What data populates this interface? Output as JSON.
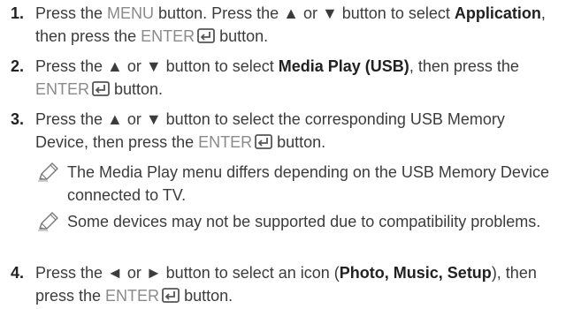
{
  "steps": [
    {
      "number": "1.",
      "segments": [
        {
          "text": "Press the ",
          "style": "plain"
        },
        {
          "text": "MENU",
          "style": "gray"
        },
        {
          "text": " button. Press the ▲  or ▼  button to select ",
          "style": "plain"
        },
        {
          "text": "Application",
          "style": "bold"
        },
        {
          "text": ", then press the ",
          "style": "plain"
        },
        {
          "text": "ENTER",
          "style": "gray"
        },
        {
          "text": " button.",
          "style": "plain"
        }
      ]
    },
    {
      "number": "2.",
      "segments": [
        {
          "text": "Press the ▲ or ▼ button to select ",
          "style": "plain"
        },
        {
          "text": "Media Play (USB)",
          "style": "bold"
        },
        {
          "text": ", then press the ",
          "style": "plain"
        },
        {
          "text": "ENTER",
          "style": "gray"
        },
        {
          "text": " button.",
          "style": "plain"
        }
      ]
    },
    {
      "number": "3.",
      "segments": [
        {
          "text": "Press the ▲ or ▼  button to select the corresponding USB Memory Device, then press the ",
          "style": "plain"
        },
        {
          "text": "ENTER",
          "style": "gray"
        },
        {
          "text": " button.",
          "style": "plain"
        }
      ]
    },
    {
      "number": "4.",
      "segments": [
        {
          "text": "Press the ◄ or ► button to select an icon (",
          "style": "plain"
        },
        {
          "text": "Photo, Music, Setup",
          "style": "bold"
        },
        {
          "text": "), then press the ",
          "style": "plain"
        },
        {
          "text": "ENTER",
          "style": "gray"
        },
        {
          "text": " button.",
          "style": "plain"
        }
      ]
    }
  ],
  "notes": [
    {
      "icon": "pencil-note-icon",
      "text": "The Media Play menu differs depending on the USB Memory Device connected to TV."
    },
    {
      "icon": "pencil-note-icon",
      "text": "Some devices may not be supported due to compatibility problems."
    }
  ],
  "colors": {
    "text": "#3c3c3c",
    "gray_keyword": "#8a8a8a",
    "bold": "#222222"
  }
}
